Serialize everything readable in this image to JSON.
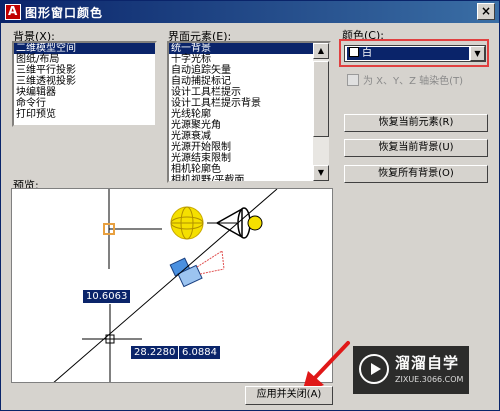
{
  "window": {
    "title": "图形窗口颜色",
    "close_glyph": "×"
  },
  "background_list": {
    "label": "背景(X):",
    "items": [
      "二维模型空间",
      "图纸/布局",
      "三维平行投影",
      "三维透视投影",
      "块编辑器",
      "命令行",
      "打印预览"
    ],
    "selected_index": 0
  },
  "element_list": {
    "label": "界面元素(E):",
    "items": [
      "统一背景",
      "十字光标",
      "自动追踪矢量",
      "自动捕捉标记",
      "设计工具栏提示",
      "设计工具栏提示背景",
      "光线轮廓",
      "光源聚光角",
      "光源衰减",
      "光源开始限制",
      "光源结束限制",
      "相机轮廓色",
      "相机视野/平截面"
    ],
    "selected_index": 0
  },
  "color": {
    "label": "颜色(C):",
    "selected_value": "白",
    "tint_checkbox_label": "为 X、Y、Z 轴染色(T)",
    "tint_checked": false
  },
  "buttons": {
    "restore_element": "恢复当前元素(R)",
    "restore_background": "恢复当前背景(U)",
    "restore_all": "恢复所有背景(O)",
    "apply_close": "应用并关闭(A)"
  },
  "preview": {
    "label": "预览:",
    "measure1": "10.6063",
    "measure2": "28.2280",
    "measure3": "6.0884"
  },
  "watermark": {
    "brand": "溜溜自学",
    "url": "ZIXUE.3066.COM"
  },
  "colors": {
    "title_start": "#0a246a",
    "title_end": "#3a6ea5",
    "selection": "#0a246a",
    "highlight_border": "#e04040"
  }
}
